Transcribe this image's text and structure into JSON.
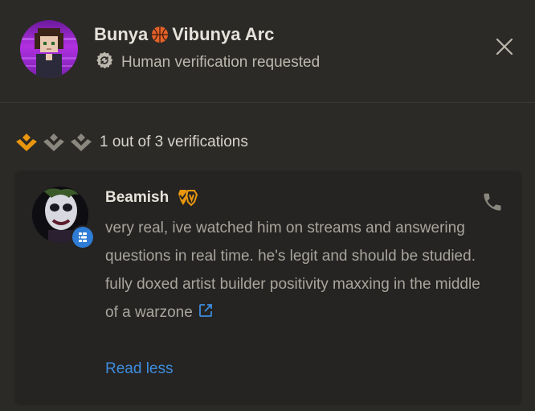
{
  "header": {
    "name_part1": "Bunya",
    "name_part2": "Vibunya Arc",
    "emoji_icon": "basketball-icon",
    "status_icon": "gear-refresh-icon",
    "status_text": "Human verification requested",
    "close_icon": "close-icon"
  },
  "verification": {
    "total": 3,
    "completed": 1,
    "active_color": "#e8960e",
    "inactive_color": "#8a877f",
    "text": "1 out of 3 verifications"
  },
  "card": {
    "name": "Beamish",
    "badge_icon": "verified-shield-icon",
    "avatar_badge_icon": "stack-icon",
    "text": "very real, ive watched him on streams and answering questions in real time. he's legit and should be studied. fully doxed artist builder positivity maxxing in the middle of a warzone",
    "external_link_icon": "external-link-icon",
    "read_less_label": "Read less",
    "phone_icon": "phone-icon"
  },
  "colors": {
    "background": "#2b2a27",
    "card": "#252422",
    "accent_orange": "#e8960e",
    "link_blue": "#3d8de0"
  }
}
